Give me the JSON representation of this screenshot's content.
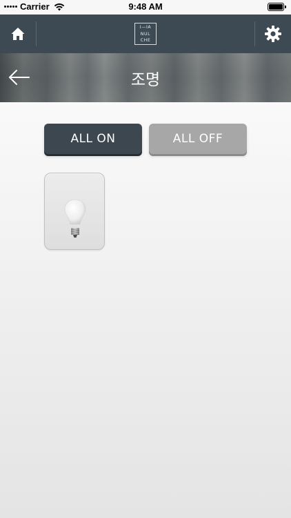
{
  "status_bar": {
    "carrier": "Carrier",
    "time": "9:48 AM"
  },
  "header": {
    "logo_lines": [
      "I—IA",
      "NUL",
      "CHE"
    ],
    "icons": [
      "home-icon",
      "gear-icon"
    ]
  },
  "banner": {
    "title": "조명",
    "back_icon": "arrow-left-icon"
  },
  "controls": {
    "all_on_label": "ALL ON",
    "all_off_label": "ALL OFF"
  },
  "devices": [
    {
      "icon": "light-bulb-icon"
    }
  ],
  "colors": {
    "header_bg": "#3e4a53",
    "all_on_bg": "#3d4750",
    "all_off_bg": "#a7a7a7",
    "banner_title": "#ffffff"
  }
}
